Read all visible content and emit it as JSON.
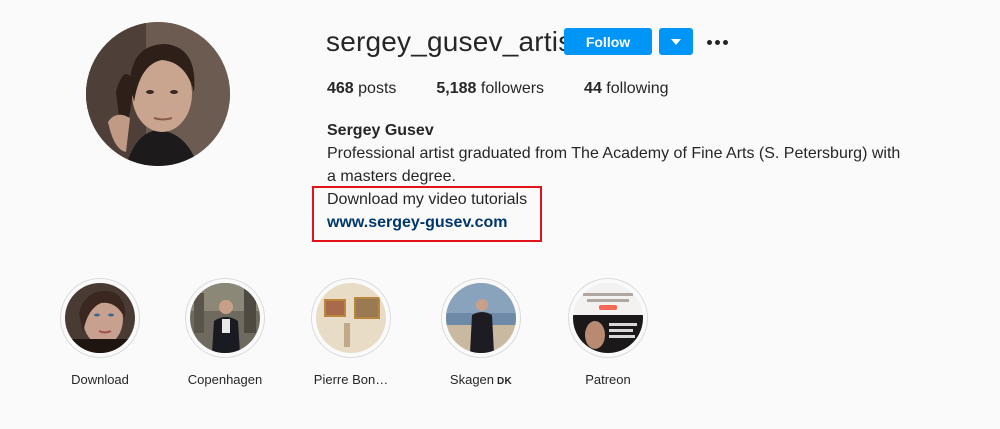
{
  "profile": {
    "username": "sergey_gusev_artist",
    "follow_label": "Follow",
    "posts_count": "468",
    "posts_label": "posts",
    "followers_count": "5,188",
    "followers_label": "followers",
    "following_count": "44",
    "following_label": "following",
    "full_name": "Sergey Gusev",
    "bio_line1": "Professional artist graduated from The Academy of Fine Arts (S. Petersburg) with a masters degree.",
    "bio_line2": "Download my video tutorials",
    "website": "www.sergey-gusev.com"
  },
  "highlights": [
    {
      "label": "Download",
      "icon": "portrait-woman"
    },
    {
      "label": "Copenhagen",
      "icon": "man-in-city"
    },
    {
      "label": "Pierre Bon…",
      "icon": "gallery-paintings"
    },
    {
      "label": "Skagen",
      "suffix": "DK",
      "icon": "man-at-sea"
    },
    {
      "label": "Patreon",
      "icon": "patreon-post"
    }
  ],
  "colors": {
    "accent": "#0095f6",
    "link": "#00376b",
    "annotation": "#e0131a"
  }
}
